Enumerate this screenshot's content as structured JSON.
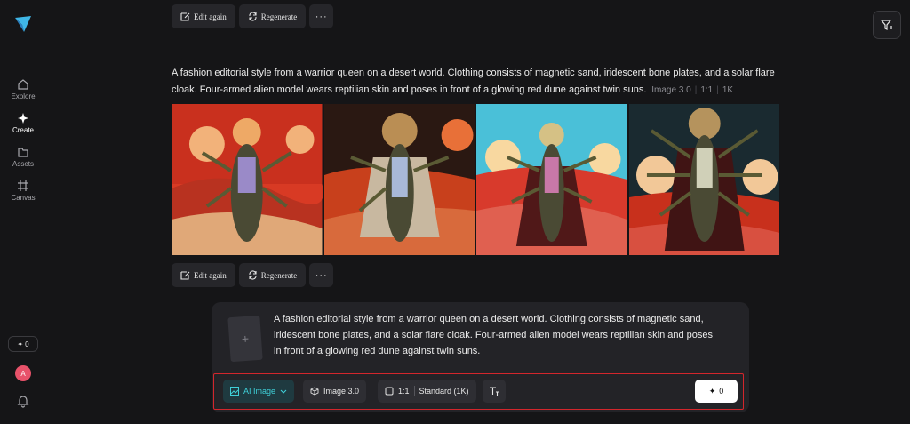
{
  "sidebar": {
    "items": [
      {
        "label": "Explore",
        "icon": "home-icon"
      },
      {
        "label": "Create",
        "icon": "sparkle-icon"
      },
      {
        "label": "Assets",
        "icon": "folder-icon"
      },
      {
        "label": "Canvas",
        "icon": "frame-icon"
      }
    ],
    "credits": "0",
    "avatar_initial": "A"
  },
  "actions": {
    "edit_again": "Edit again",
    "regenerate": "Regenerate",
    "more": "···"
  },
  "result": {
    "prompt": "A fashion editorial style from a warrior queen on a desert world. Clothing consists of magnetic sand, iridescent bone plates, and a solar flare cloak. Four-armed alien model wears reptilian skin and poses in front of a glowing red dune against twin suns.",
    "model": "Image 3.0",
    "ratio": "1:1",
    "resolution": "1K"
  },
  "composer": {
    "prompt": "A fashion editorial style from a warrior queen on a desert world. Clothing consists of magnetic sand, iridescent bone plates, and a solar flare cloak. Four-armed alien model wears reptilian skin and poses in front of a glowing red dune against twin suns.",
    "add_reference": "+",
    "mode": "AI Image",
    "model": "Image 3.0",
    "ratio": "1:1",
    "quality": "Standard (1K)",
    "generate_credits": "0"
  },
  "colors": {
    "accent": "#3fd0d8",
    "highlight_border": "#d3262c",
    "avatar": "#e8526a"
  }
}
